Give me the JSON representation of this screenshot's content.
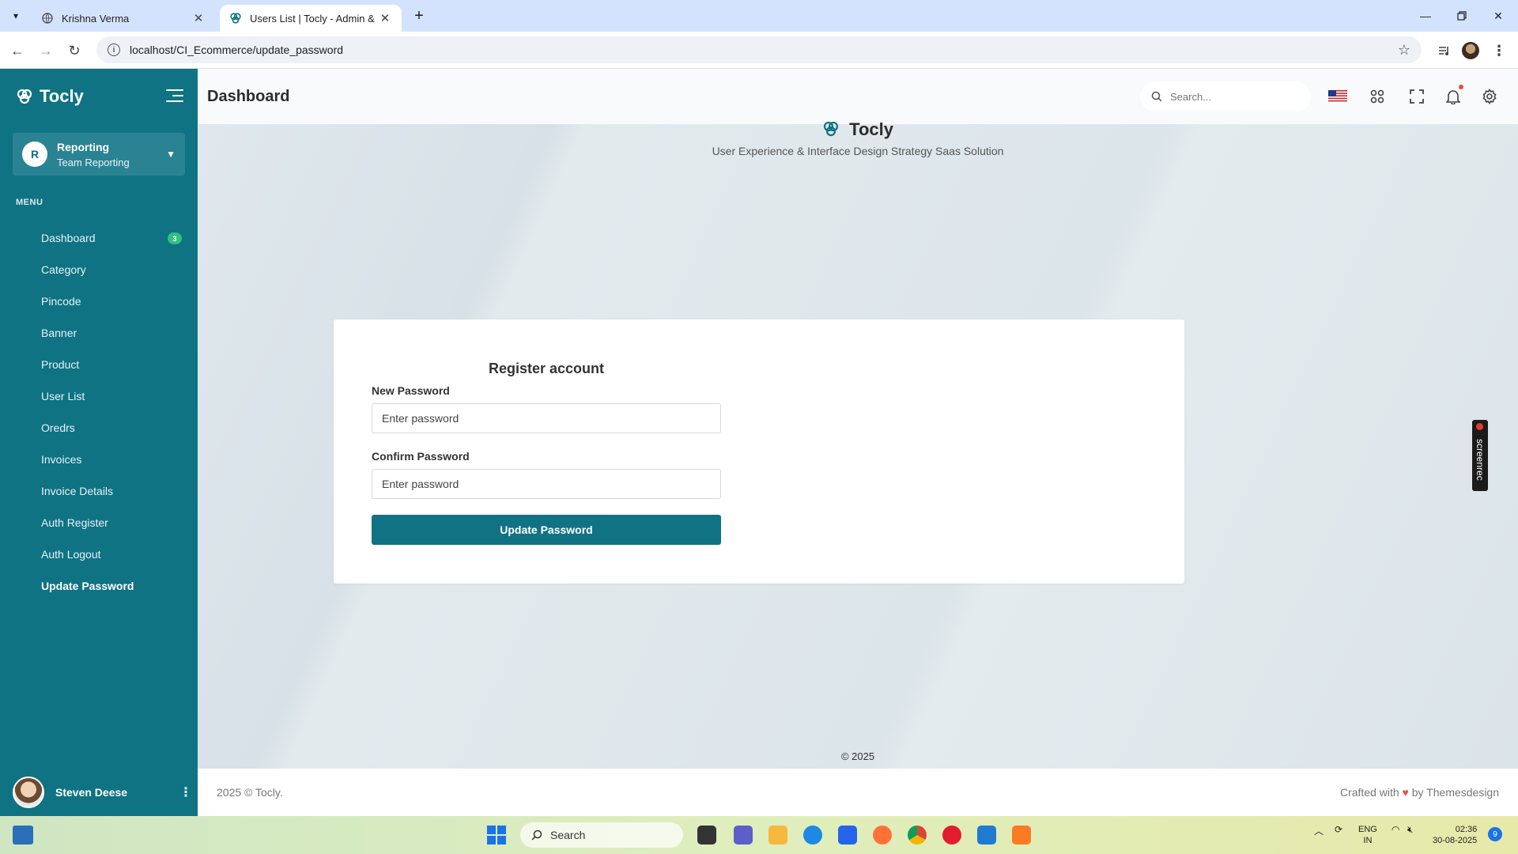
{
  "browser": {
    "tabs": [
      {
        "title": "Krishna Verma",
        "active": false
      },
      {
        "title": "Users List | Tocly - Admin & Da",
        "active": true
      }
    ],
    "url": "localhost/CI_Ecommerce/update_password"
  },
  "sidebar": {
    "brand": "Tocly",
    "team": {
      "initial": "R",
      "name": "Reporting",
      "subtitle": "Team Reporting"
    },
    "menu_label": "MENU",
    "items": [
      {
        "label": "Dashboard",
        "badge": "3"
      },
      {
        "label": "Category"
      },
      {
        "label": "Pincode"
      },
      {
        "label": "Banner"
      },
      {
        "label": "Product"
      },
      {
        "label": "User List"
      },
      {
        "label": "Oredrs"
      },
      {
        "label": "Invoices"
      },
      {
        "label": "Invoice Details"
      },
      {
        "label": "Auth Register"
      },
      {
        "label": "Auth Logout"
      },
      {
        "label": "Update Password",
        "active": true
      }
    ],
    "user": {
      "name": "Steven Deese"
    }
  },
  "header": {
    "title": "Dashboard",
    "search_placeholder": "Search..."
  },
  "hero": {
    "brand": "Tocly",
    "tagline": "User Experience & Interface Design Strategy Saas Solution"
  },
  "form": {
    "title": "Register account",
    "new_password_label": "New Password",
    "new_password_placeholder": "Enter password",
    "confirm_password_label": "Confirm Password",
    "confirm_password_placeholder": "Enter password",
    "submit_label": "Update Password"
  },
  "copyright_center": "© 2025",
  "screenrec_label": "screenrec",
  "footer": {
    "left": "2025 © Tocly.",
    "right_prefix": "Crafted with",
    "right_suffix": "by Themesdesign"
  },
  "taskbar": {
    "search_label": "Search",
    "lang_line1": "ENG",
    "lang_line2": "IN",
    "time": "02:36",
    "date": "30-08-2025",
    "notification_count": "9"
  },
  "colors": {
    "primary": "#0f7384",
    "badge": "#2ec27e",
    "heart": "#e5533d"
  }
}
